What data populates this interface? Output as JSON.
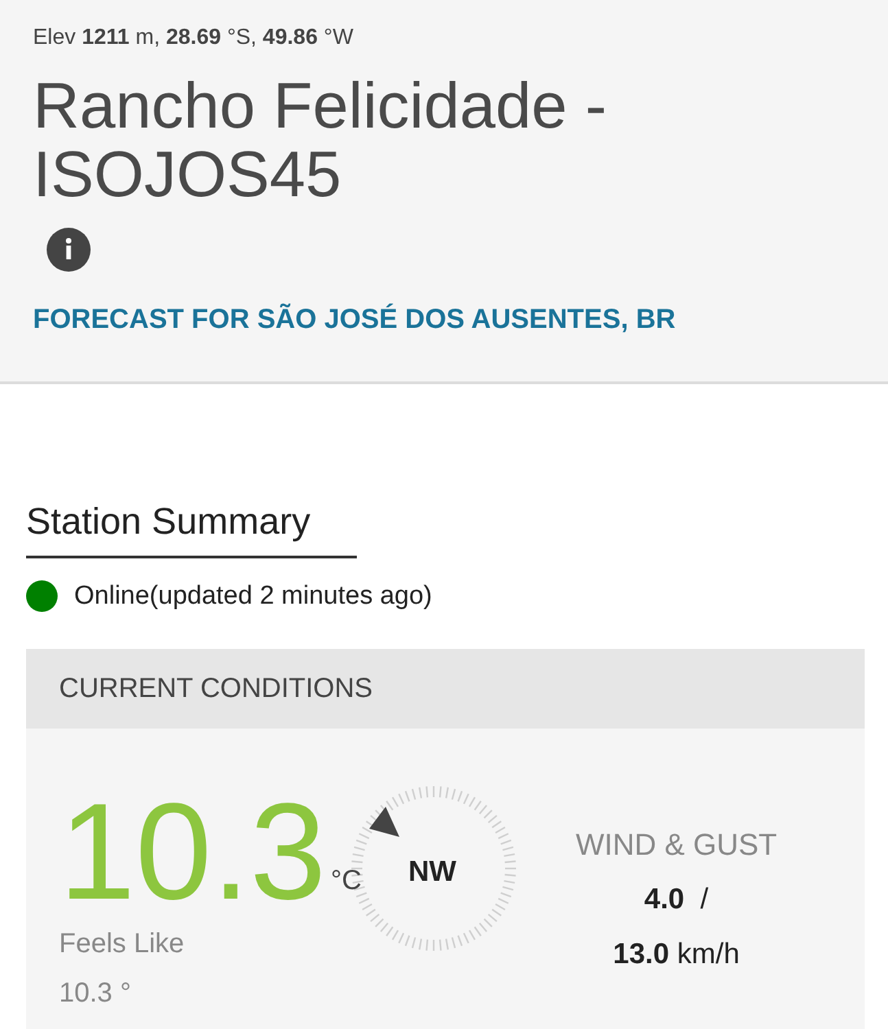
{
  "header": {
    "location_line": "Elev **1211** m, **28.69** °S, **49.86** °W",
    "title": "Rancho Felicidade - ISOJOS45",
    "forecast_link": "FORECAST FOR SÃO JOSÉ DOS AUSENTES, BR"
  },
  "summary": {
    "heading": "Station Summary",
    "status": {
      "text": "Online(updated 2 minutes ago)",
      "color": "#008000"
    }
  },
  "current_conditions": {
    "heading": "CURRENT CONDITIONS",
    "temperature": "10.3",
    "unit": "°C",
    "feels_like_label": "Feels Like",
    "feels_like_value": "10.3 °",
    "wind_direction": "NW",
    "wind_label": "WIND & GUST",
    "wind_speed": "**4.0**  /",
    "gust_speed": "**13.0** km/h"
  }
}
